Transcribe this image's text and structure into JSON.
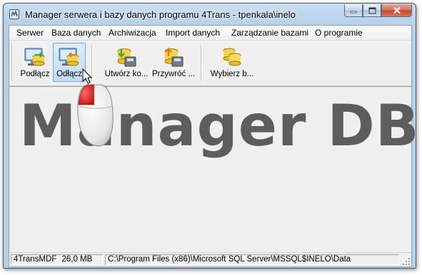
{
  "window": {
    "title": "Manager serwera i bazy danych programu 4Trans - tpenkala\\inelo",
    "minimize_label": "minimize",
    "maximize_label": "maximize",
    "close_label": "close"
  },
  "menu": {
    "items": [
      "Serwer",
      "Baza danych",
      "Archiwizacja",
      "Import danych",
      "Zarządzanie bazami",
      "O programie"
    ]
  },
  "toolbar": {
    "buttons": [
      {
        "label": "Podłącz",
        "icon": "connect-database-icon",
        "active": false
      },
      {
        "label": "Odłącz",
        "icon": "disconnect-database-icon",
        "active": true
      },
      {
        "label": "Utwórz ko...",
        "icon": "create-backup-icon",
        "active": false
      },
      {
        "label": "Przywróć ...",
        "icon": "restore-backup-icon",
        "active": false
      },
      {
        "label": "Wybierz b...",
        "icon": "select-database-icon",
        "active": false
      }
    ]
  },
  "main": {
    "watermark": "Manager DB"
  },
  "statusbar": {
    "db_name": "4TransMDF",
    "db_size": "26,0 MB",
    "data_path": "C:\\Program Files (x86)\\Microsoft SQL Server\\MSSQL$INELO\\Data"
  },
  "colors": {
    "titlebar": "#b6d0ea",
    "close_button": "#c2442b",
    "active_button": "#c1dcf6",
    "watermark": "#5d5d5d",
    "mouse_button_highlight": "#e11d1d"
  }
}
